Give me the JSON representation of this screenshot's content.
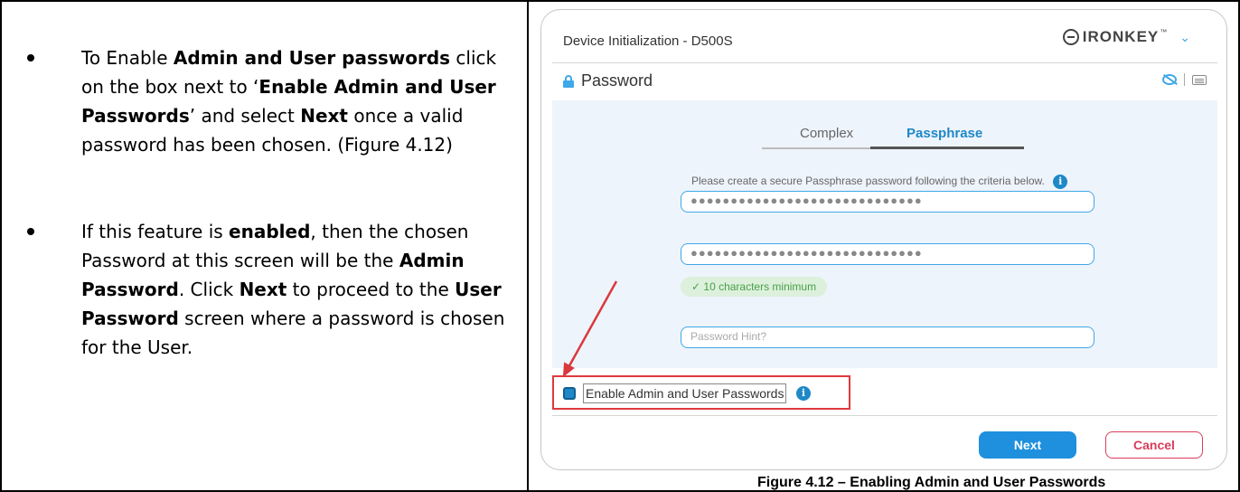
{
  "instructions": {
    "bullet1": {
      "p1": "To Enable ",
      "b1": "Admin and User passwords",
      "p2": " click on the box next to ‘",
      "b2": "Enable Admin and User Passwords",
      "p3": "’ and select ",
      "b3": "Next",
      "p4": " once a valid password has been chosen. (Figure 4.12)"
    },
    "bullet2": {
      "p1": "If this feature is ",
      "b1": "enabled",
      "p2": ", then the chosen Password at this screen will be the ",
      "b2": "Admin Password",
      "p3": ". Click ",
      "b3": "Next",
      "p4": " to proceed to the ",
      "b4": "User Password",
      "p5": " screen where a password is chosen for the User."
    }
  },
  "figure": {
    "window_title": "Device Initialization - D500S",
    "brand": {
      "name": "IRONKEY",
      "tm": "™",
      "icon": "ironkey-logo-icon"
    },
    "section_title": "Password",
    "icons": {
      "lock": "lock-icon",
      "eye": "eye-slash-icon",
      "keyboard": "keyboard-icon",
      "info": "info-icon",
      "menu": "chevron-down-icon"
    },
    "tabs": [
      "Complex",
      "Passphrase"
    ],
    "active_tab": "Passphrase",
    "criteria_text": "Please create a secure Passphrase password following the criteria below.",
    "password_value": "●●●●●●●●●●●●●●●●●●●●●●●●●●●●●",
    "confirm_value": "●●●●●●●●●●●●●●●●●●●●●●●●●●●●●",
    "requirement_badge": "✓ 10 characters minimum",
    "hint_placeholder": "Password Hint?",
    "enable_checkbox_label": "Enable Admin and User Passwords",
    "enable_checked": true,
    "next_label": "Next",
    "cancel_label": "Cancel",
    "colors": {
      "accent": "#1e88c8",
      "annotation_red": "#e0393e",
      "cancel": "#d93c5c",
      "panel_bg": "#eef4fb"
    }
  },
  "caption": "Figure 4.12 – Enabling Admin and User Passwords"
}
